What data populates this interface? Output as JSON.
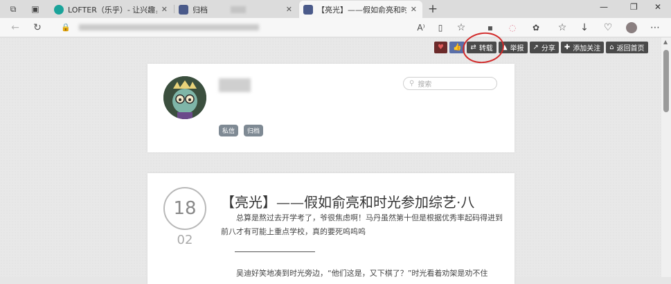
{
  "browser": {
    "tabs": [
      {
        "title": "LOFTER（乐乎）- 让兴趣，更有"
      },
      {
        "title": "归档"
      },
      {
        "title": "【亮光】——假如俞亮和时光参"
      }
    ],
    "new_tab": "+",
    "window_controls": {
      "minimize": "—",
      "maximize": "❐",
      "close": "✕"
    },
    "address": {
      "lock": "🔒"
    }
  },
  "icons": {
    "workspaces": "⧉",
    "tab_actions": "▣",
    "back": "←",
    "refresh": "↻",
    "read_aloud": "A⁾",
    "immersive": "▯",
    "favorite": "☆",
    "ext1": "▪",
    "ext2": "◌",
    "extensions": "✿",
    "favorites_bar": "☆",
    "downloads": "↓",
    "performance": "♡",
    "more": "⋯"
  },
  "toolbar": {
    "heart_icon": "♥",
    "like_icon": "👍",
    "reblog": "转载",
    "report": "举报",
    "share": "分享",
    "follow": "添加关注",
    "home": "返回首页"
  },
  "profile": {
    "search_placeholder": "搜索",
    "tags": [
      "私信",
      "归档"
    ]
  },
  "post": {
    "day": "18",
    "month": "02",
    "title": "【亮光】——假如俞亮和时光参加综艺·八",
    "paragraph1": "总算是熬过去开学考了，爷很焦虑啊！马丹虽然第十但是根据优秀率起码得进到前八才有可能上重点学校，真的要死呜呜呜",
    "paragraph2": "吴迪好笑地凑到时光旁边，“他们这是，又下棋了？”时光看着劝架是劝不住"
  },
  "colors": {
    "annotation_circle": "#d22a2a",
    "toolbar_button": "#4a4a4a",
    "tag_bg": "#7f8a94"
  }
}
